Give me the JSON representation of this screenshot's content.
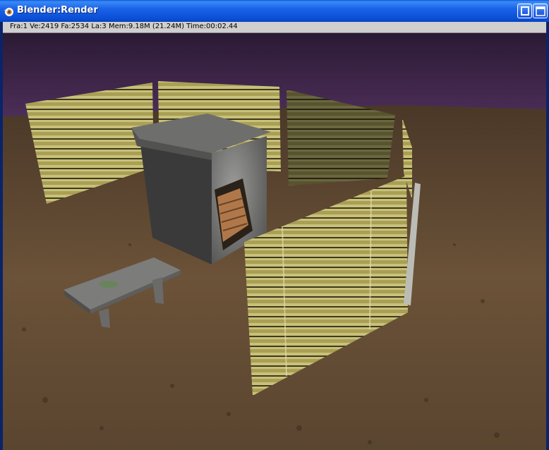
{
  "window": {
    "title": "Blender:Render",
    "status": "Fra:1  Ve:2419 Fa:2534 La:3 Mem:9.18M (21.24M) Time:00:02.44"
  },
  "colors": {
    "titlebar": "#0a5ce0",
    "sky": "#3a2244",
    "ground": "#5a4530",
    "wood": "#b8b070",
    "stone": "#7a7a78"
  },
  "icons": {
    "app": "blender-icon",
    "minimize": "minimize-icon",
    "maximize": "maximize-icon"
  }
}
